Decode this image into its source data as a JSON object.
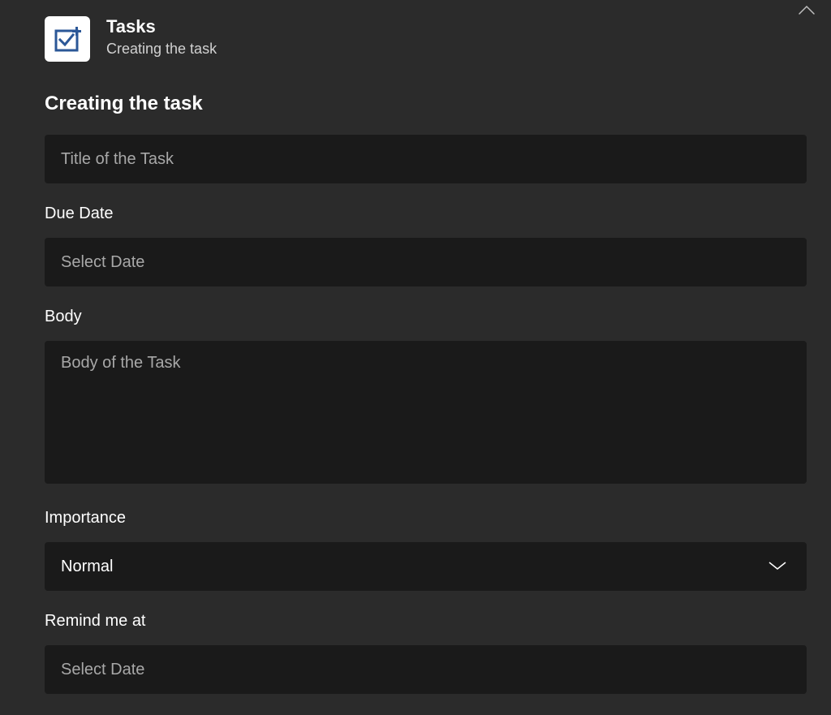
{
  "header": {
    "title": "Tasks",
    "subtitle": "Creating the task"
  },
  "form": {
    "section_title": "Creating the task",
    "title": {
      "placeholder": "Title of the Task",
      "value": ""
    },
    "due_date": {
      "label": "Due Date",
      "placeholder": "Select Date",
      "value": ""
    },
    "body": {
      "label": "Body",
      "placeholder": "Body of the Task",
      "value": ""
    },
    "importance": {
      "label": "Importance",
      "selected": "Normal"
    },
    "remind_me": {
      "label": "Remind me at",
      "placeholder": "Select Date",
      "value": ""
    }
  },
  "icons": {
    "tasks": "tasks-checkbox-icon",
    "close": "close-icon",
    "chevron": "chevron-down-icon"
  }
}
